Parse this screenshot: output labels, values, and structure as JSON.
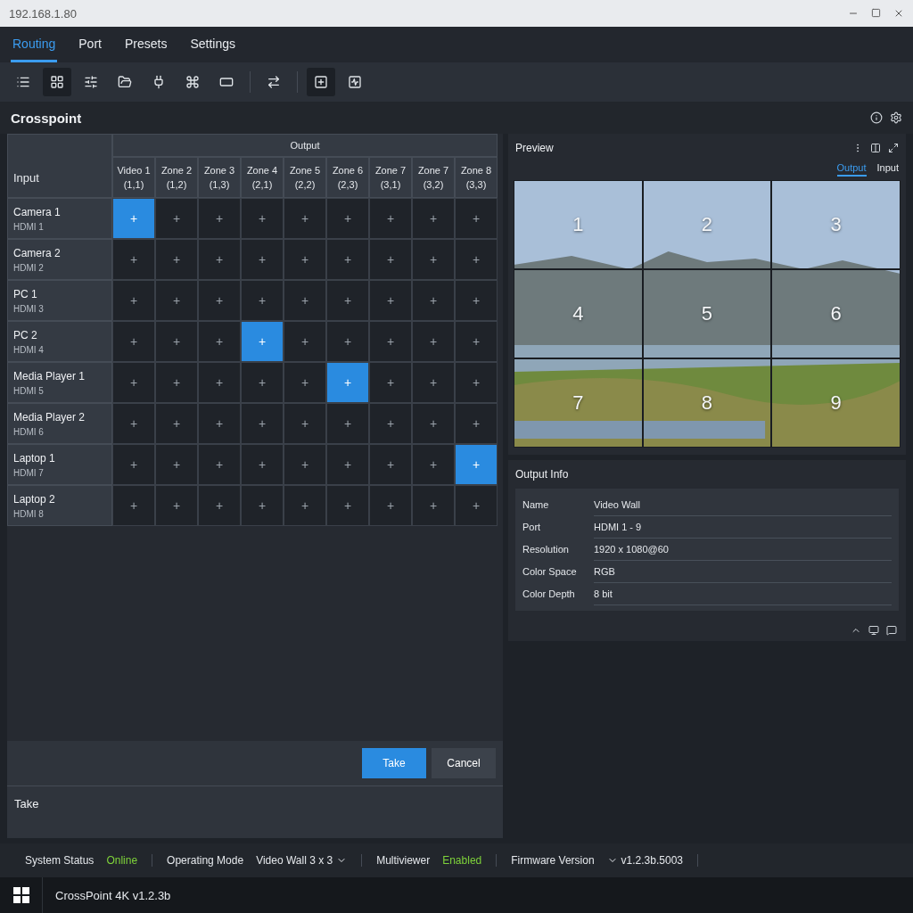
{
  "window": {
    "address": "192.168.1.80"
  },
  "tabs": [
    {
      "label": "Routing",
      "selected": true
    },
    {
      "label": "Port",
      "selected": false
    },
    {
      "label": "Presets",
      "selected": false
    },
    {
      "label": "Settings",
      "selected": false
    }
  ],
  "toolbar": [
    {
      "selected": false
    },
    {
      "selected": true
    },
    {
      "selected": false
    },
    {
      "selected": false
    },
    {
      "selected": false
    },
    {
      "selected": false
    },
    {
      "selected": false
    },
    {
      "selected": false
    },
    {
      "selected": true
    },
    {
      "selected": false
    }
  ],
  "crosspoint": {
    "title": "Crosspoint",
    "input_header": "Input",
    "output_header": "Output",
    "columns": [
      {
        "name": "Video 1",
        "pos": "(1,1)"
      },
      {
        "name": "Zone 2",
        "pos": "(1,2)"
      },
      {
        "name": "Zone 3",
        "pos": "(1,3)"
      },
      {
        "name": "Zone 4",
        "pos": "(2,1)"
      },
      {
        "name": "Zone 5",
        "pos": "(2,2)"
      },
      {
        "name": "Zone 6",
        "pos": "(2,3)"
      },
      {
        "name": "Zone 7",
        "pos": "(3,1)"
      },
      {
        "name": "Zone 7",
        "pos": "(3,2)"
      },
      {
        "name": "Zone 8",
        "pos": "(3,3)"
      }
    ],
    "rows": [
      {
        "name": "Camera 1",
        "port": "HDMI 1",
        "cells": [
          {
            "text": "+",
            "selected": true
          },
          {
            "text": "+",
            "selected": false
          },
          {
            "text": "+",
            "selected": false
          },
          {
            "text": "+",
            "selected": false
          },
          {
            "text": "+",
            "selected": false
          },
          {
            "text": "+",
            "selected": false
          },
          {
            "text": "+",
            "selected": false
          },
          {
            "text": "+",
            "selected": false
          },
          {
            "text": "+",
            "selected": false
          }
        ]
      },
      {
        "name": "Camera 2",
        "port": "HDMI 2",
        "cells": [
          {
            "text": "+",
            "selected": false
          },
          {
            "text": "+",
            "selected": false
          },
          {
            "text": "+",
            "selected": false
          },
          {
            "text": "+",
            "selected": false
          },
          {
            "text": "+",
            "selected": false
          },
          {
            "text": "+",
            "selected": false
          },
          {
            "text": "+",
            "selected": false
          },
          {
            "text": "+",
            "selected": false
          },
          {
            "text": "+",
            "selected": false
          }
        ]
      },
      {
        "name": "PC 1",
        "port": "HDMI 3",
        "cells": [
          {
            "text": "+",
            "selected": false
          },
          {
            "text": "+",
            "selected": false
          },
          {
            "text": "+",
            "selected": false
          },
          {
            "text": "+",
            "selected": false
          },
          {
            "text": "+",
            "selected": false
          },
          {
            "text": "+",
            "selected": false
          },
          {
            "text": "+",
            "selected": false
          },
          {
            "text": "+",
            "selected": false
          },
          {
            "text": "+",
            "selected": false
          }
        ]
      },
      {
        "name": "PC 2",
        "port": "HDMI 4",
        "cells": [
          {
            "text": "+",
            "selected": false
          },
          {
            "text": "+",
            "selected": false
          },
          {
            "text": "+",
            "selected": false
          },
          {
            "text": "+",
            "selected": true
          },
          {
            "text": "+",
            "selected": false
          },
          {
            "text": "+",
            "selected": false
          },
          {
            "text": "+",
            "selected": false
          },
          {
            "text": "+",
            "selected": false
          },
          {
            "text": "+",
            "selected": false
          }
        ]
      },
      {
        "name": "Media Player 1",
        "port": "HDMI 5",
        "cells": [
          {
            "text": "+",
            "selected": false
          },
          {
            "text": "+",
            "selected": false
          },
          {
            "text": "+",
            "selected": false
          },
          {
            "text": "+",
            "selected": false
          },
          {
            "text": "+",
            "selected": false
          },
          {
            "text": "+",
            "selected": true
          },
          {
            "text": "+",
            "selected": false
          },
          {
            "text": "+",
            "selected": false
          },
          {
            "text": "+",
            "selected": false
          }
        ]
      },
      {
        "name": "Media Player 2",
        "port": "HDMI 6",
        "cells": [
          {
            "text": "+",
            "selected": false
          },
          {
            "text": "+",
            "selected": false
          },
          {
            "text": "+",
            "selected": false
          },
          {
            "text": "+",
            "selected": false
          },
          {
            "text": "+",
            "selected": false
          },
          {
            "text": "+",
            "selected": false
          },
          {
            "text": "+",
            "selected": false
          },
          {
            "text": "+",
            "selected": false
          },
          {
            "text": "+",
            "selected": false
          }
        ]
      },
      {
        "name": "Laptop 1",
        "port": "HDMI 7",
        "cells": [
          {
            "text": "+",
            "selected": false
          },
          {
            "text": "+",
            "selected": false
          },
          {
            "text": "+",
            "selected": false
          },
          {
            "text": "+",
            "selected": false
          },
          {
            "text": "+",
            "selected": false
          },
          {
            "text": "+",
            "selected": false
          },
          {
            "text": "+",
            "selected": false
          },
          {
            "text": "+",
            "selected": false
          },
          {
            "text": "+",
            "selected": true
          }
        ]
      },
      {
        "name": "Laptop 2",
        "port": "HDMI 8",
        "cells": [
          {
            "text": "+",
            "selected": false
          },
          {
            "text": "+",
            "selected": false
          },
          {
            "text": "+",
            "selected": false
          },
          {
            "text": "+",
            "selected": false
          },
          {
            "text": "+",
            "selected": false
          },
          {
            "text": "+",
            "selected": false
          },
          {
            "text": "+",
            "selected": false
          },
          {
            "text": "+",
            "selected": false
          },
          {
            "text": "+",
            "selected": false
          }
        ]
      }
    ],
    "take": {
      "label": "Take",
      "buttons": [
        {
          "label": "Take",
          "kind": "primary"
        },
        {
          "label": "Cancel",
          "kind": "secondary"
        }
      ]
    }
  },
  "preview": {
    "title": "Preview",
    "tabs": [
      {
        "label": "Output",
        "selected": true
      },
      {
        "label": "Input",
        "selected": false
      }
    ],
    "tiles": [
      "1",
      "2",
      "3",
      "4",
      "5",
      "6",
      "7",
      "8",
      "9"
    ]
  },
  "output_info": {
    "title": "Output Info",
    "rows": [
      {
        "label": "Name",
        "value": "Video Wall"
      },
      {
        "label": "Port",
        "value": "HDMI 1 - 9"
      },
      {
        "label": "Resolution",
        "value": "1920 x 1080@60"
      },
      {
        "label": "Color Space",
        "value": "RGB"
      },
      {
        "label": "Color Depth",
        "value": "8 bit"
      }
    ]
  },
  "status_bar": [
    {
      "label": "System Status",
      "value": "Online",
      "kind": "status"
    },
    {
      "label": "Operating Mode",
      "value": "Video Wall 3 x 3",
      "kind": "dropdown"
    },
    {
      "label": "Multiviewer",
      "value": "Enabled",
      "kind": "status"
    },
    {
      "label": "Firmware Version",
      "value": "v1.2.3b.5003",
      "kind": "version"
    }
  ],
  "taskbar": {
    "app": "CrossPoint 4K v1.2.3b"
  }
}
